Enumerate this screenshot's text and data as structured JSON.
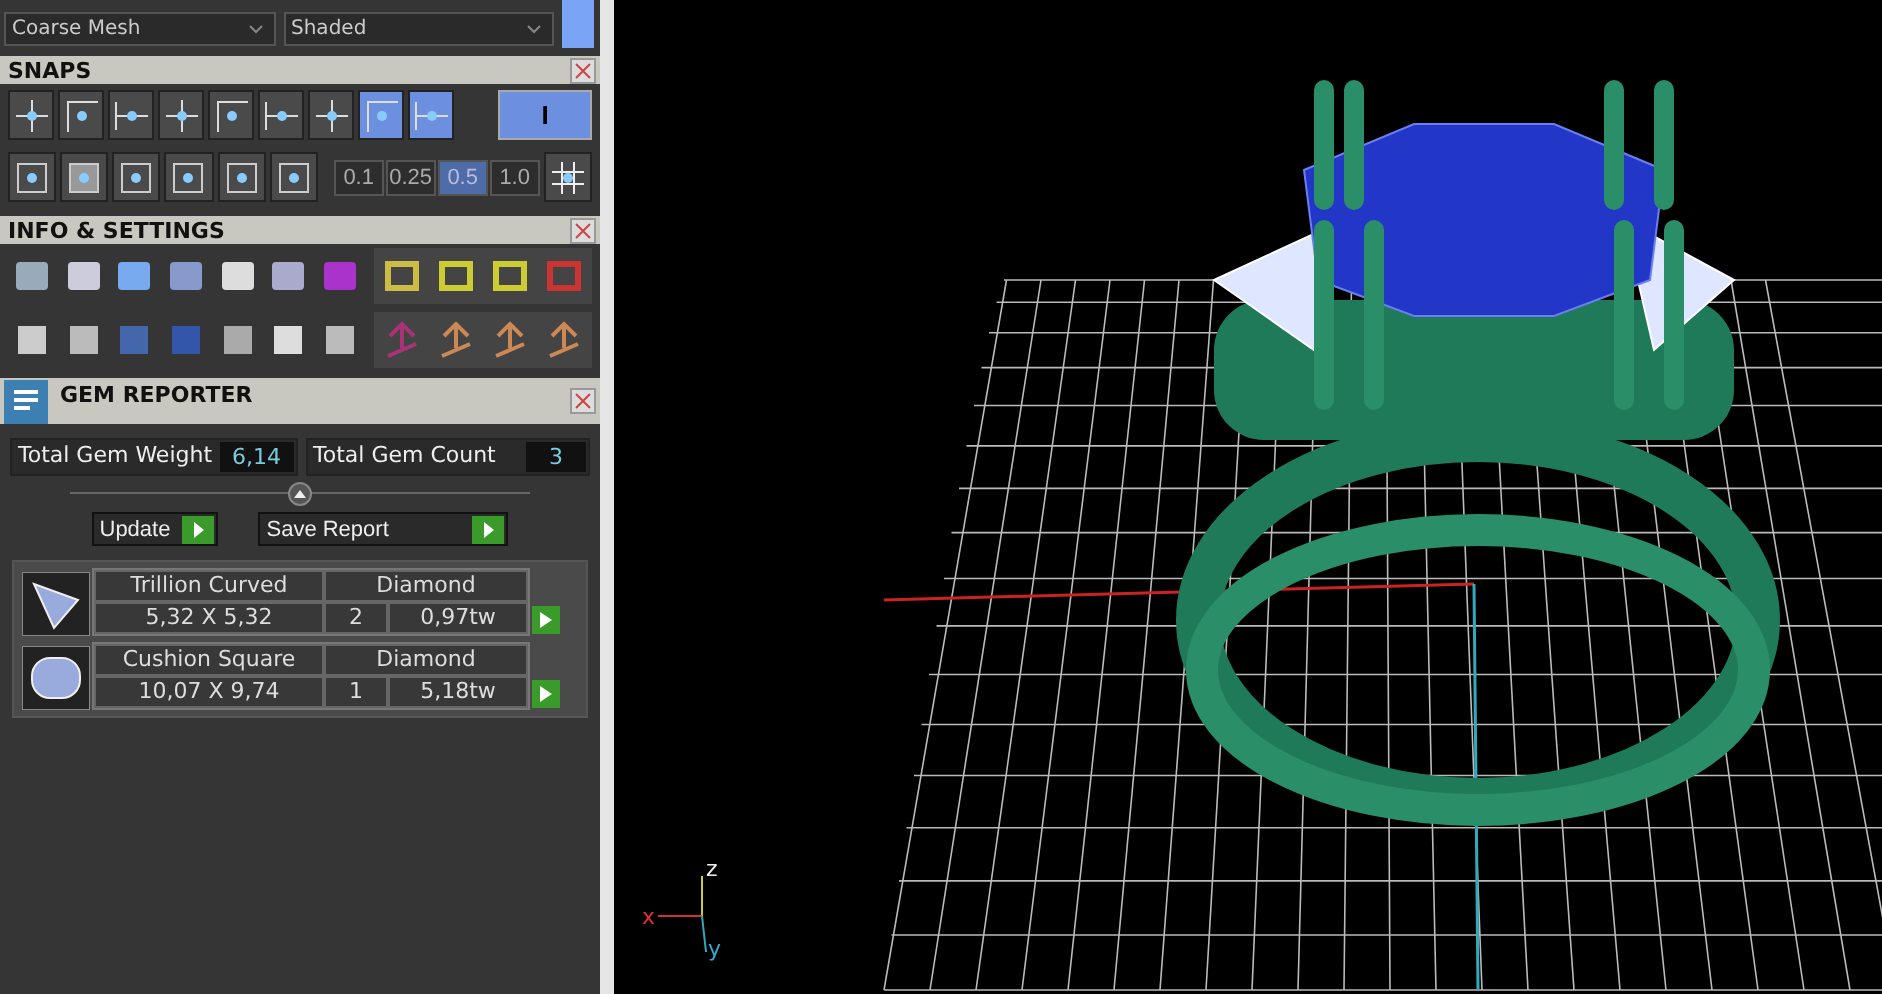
{
  "dropdowns": [
    {
      "value": "Coarse Mesh"
    },
    {
      "value": "Shaded"
    }
  ],
  "snaps": {
    "title": "SNAPS",
    "buttons": [
      {
        "selected": false
      },
      {
        "selected": false
      },
      {
        "selected": false
      },
      {
        "selected": false
      },
      {
        "selected": false
      },
      {
        "selected": false
      },
      {
        "selected": false
      },
      {
        "selected": true
      },
      {
        "selected": true
      }
    ],
    "wide_button": {
      "label": "I",
      "selected": true
    },
    "steps": [
      {
        "label": "0.1",
        "selected": false
      },
      {
        "label": "0.25",
        "selected": false
      },
      {
        "label": "0.5",
        "selected": true
      },
      {
        "label": "1.0",
        "selected": false
      }
    ]
  },
  "info": {
    "title": "INFO & SETTINGS"
  },
  "gem_reporter": {
    "title": "GEM REPORTER",
    "totals": [
      {
        "label": "Total Gem Weight",
        "value": "6,14"
      },
      {
        "label": "Total Gem Count",
        "value": "3"
      }
    ],
    "buttons": [
      "Update",
      "Save Report"
    ],
    "gems": [
      {
        "kind": "trillion",
        "name": "Trillion Curved",
        "material": "Diamond",
        "size": "5,32 X 5,32",
        "count": "2",
        "weight": "0,97tw"
      },
      {
        "kind": "cushion",
        "name": "Cushion Square",
        "material": "Diamond",
        "size": "10,07 X 9,74",
        "count": "1",
        "weight": "5,18tw"
      }
    ]
  },
  "viewport": {
    "axes": [
      "z",
      "x",
      "y"
    ]
  }
}
